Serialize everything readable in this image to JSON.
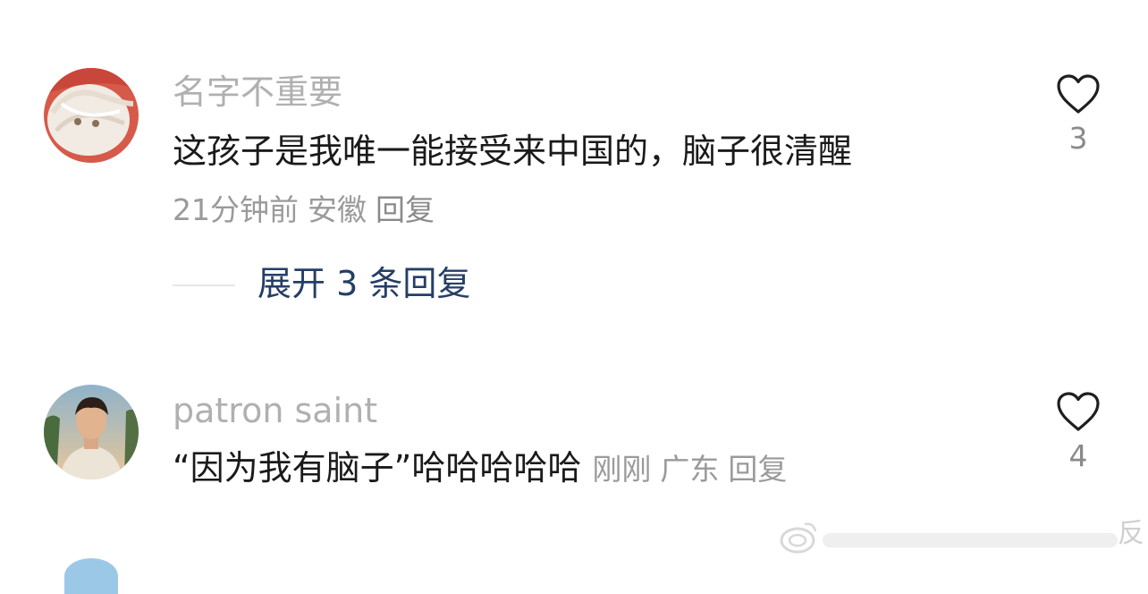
{
  "comments": [
    {
      "username": "名字不重要",
      "text": "这孩子是我唯一能接受来中国的，脑子很清醒",
      "time": "21分钟前",
      "location": "安徽",
      "reply_label": "回复",
      "likes": "3",
      "expand_label": "展开 3 条回复"
    },
    {
      "username": "patron saint",
      "text": "“因为我有脑子”哈哈哈哈哈",
      "time": "刚刚",
      "location": "广东",
      "reply_label": "回复",
      "likes": "4"
    }
  ],
  "watermark": {
    "text": "反"
  },
  "colors": {
    "username": "#b0b0b0",
    "text": "#1a1a1a",
    "meta": "#9a9a9a",
    "expand": "#253e66"
  },
  "icons": [
    "heart-outline-icon",
    "avatar"
  ]
}
